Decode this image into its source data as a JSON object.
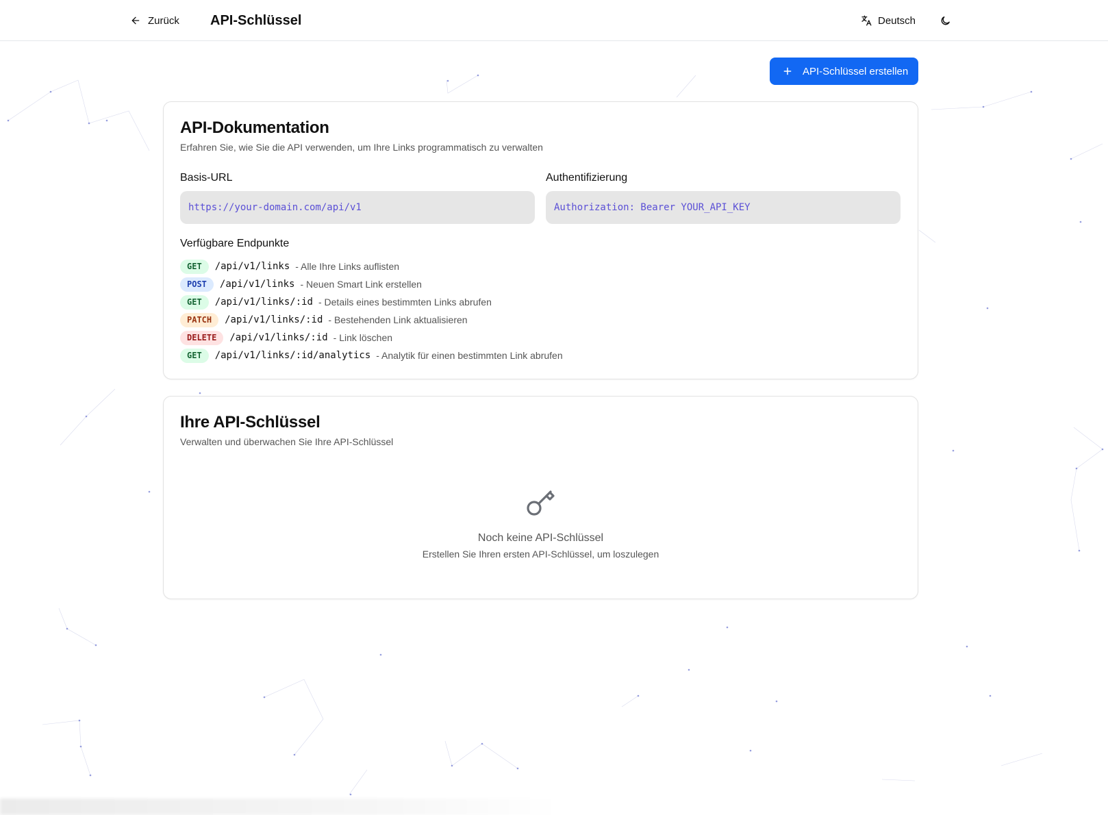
{
  "header": {
    "back_label": "Zurück",
    "title": "API-Schlüssel",
    "language_label": "Deutsch"
  },
  "actions": {
    "create_label": "API-Schlüssel erstellen"
  },
  "docs": {
    "title": "API-Dokumentation",
    "subtitle": "Erfahren Sie, wie Sie die API verwenden, um Ihre Links programmatisch zu verwalten",
    "base_url_label": "Basis-URL",
    "base_url_value": "https://your-domain.com/api/v1",
    "auth_label": "Authentifizierung",
    "auth_value": "Authorization: Bearer YOUR_API_KEY",
    "endpoints_title": "Verfügbare Endpunkte",
    "endpoints": [
      {
        "method": "GET",
        "path": "/api/v1/links",
        "desc": "- Alle Ihre Links auflisten"
      },
      {
        "method": "POST",
        "path": "/api/v1/links",
        "desc": "- Neuen Smart Link erstellen"
      },
      {
        "method": "GET",
        "path": "/api/v1/links/:id",
        "desc": "- Details eines bestimmten Links abrufen"
      },
      {
        "method": "PATCH",
        "path": "/api/v1/links/:id",
        "desc": "- Bestehenden Link aktualisieren"
      },
      {
        "method": "DELETE",
        "path": "/api/v1/links/:id",
        "desc": "- Link löschen"
      },
      {
        "method": "GET",
        "path": "/api/v1/links/:id/analytics",
        "desc": "- Analytik für einen bestimmten Link abrufen"
      }
    ]
  },
  "keys": {
    "title": "Ihre API-Schlüssel",
    "subtitle": "Verwalten und überwachen Sie Ihre API-Schlüssel",
    "empty_icon": "key-icon",
    "empty_title": "Noch keine API-Schlüssel",
    "empty_subtitle": "Erstellen Sie Ihren ersten API-Schlüssel, um loszulegen"
  },
  "colors": {
    "primary": "#1268f3",
    "code_text": "#5b50d6",
    "code_bg": "#e6e6e6",
    "get_bg": "#dcfce7",
    "post_bg": "#dbeafe",
    "patch_bg": "#ffedd5",
    "delete_bg": "#fee2e2"
  }
}
